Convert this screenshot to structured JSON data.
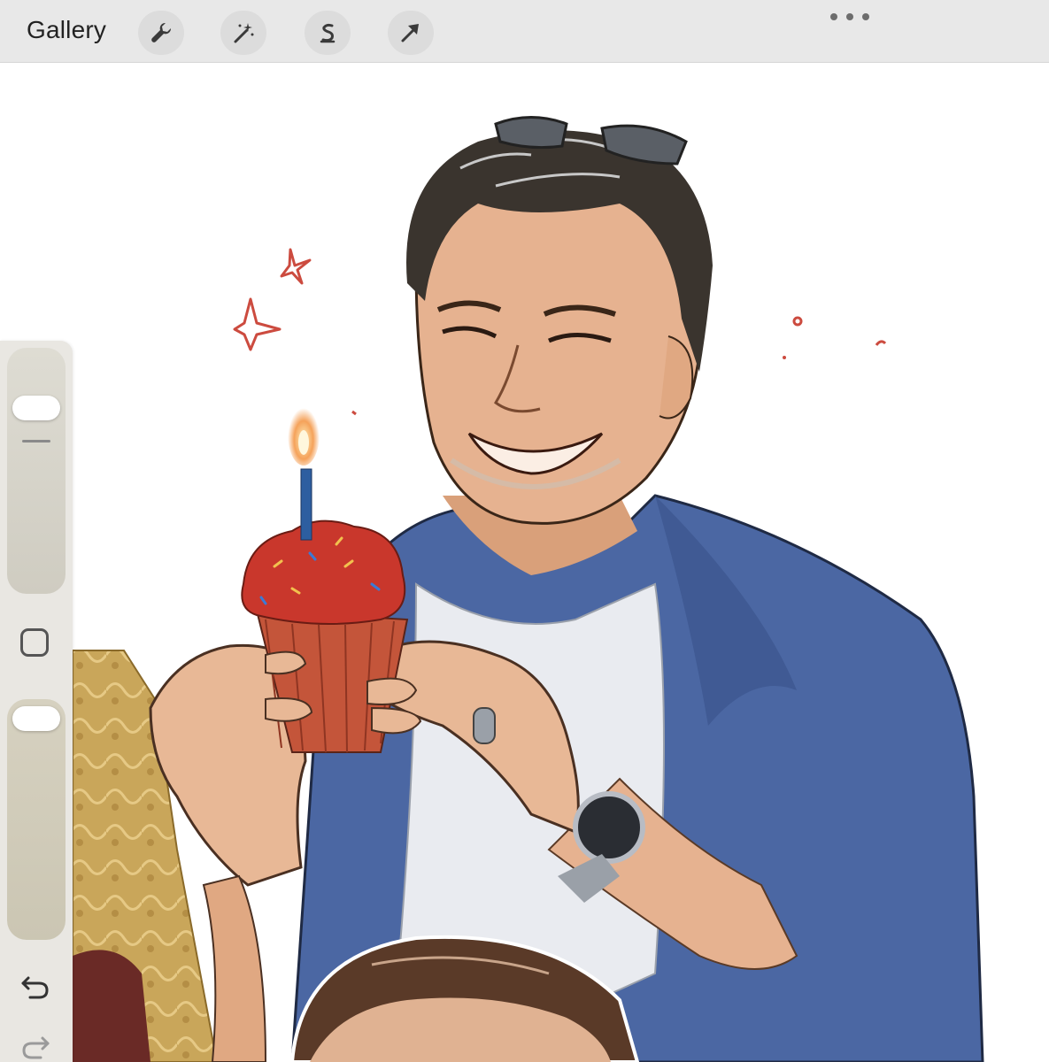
{
  "toolbar": {
    "gallery_label": "Gallery",
    "tools": [
      {
        "name": "actions",
        "icon": "wrench-icon"
      },
      {
        "name": "adjustments",
        "icon": "magic-wand-icon"
      },
      {
        "name": "selection",
        "icon": "selection-s-icon"
      },
      {
        "name": "transform",
        "icon": "arrow-cursor-icon"
      }
    ],
    "more_icon": "more-dots-icon"
  },
  "sidebar": {
    "brush_size_icon": "brush-size-slider",
    "modify_icon": "square-icon",
    "opacity_icon": "opacity-slider",
    "undo_icon": "undo-arrow-icon",
    "redo_icon": "redo-arrow-icon"
  },
  "canvas": {
    "content": "illustration-man-holding-cupcake"
  },
  "colors": {
    "toolbar_bg": "#e8e8e8",
    "sidebar_bg": "#e9e7e2",
    "jacket_blue": "#4b67a3",
    "frosting_red": "#c9372c",
    "skin": "#e6b290",
    "hair": "#3a342e"
  }
}
